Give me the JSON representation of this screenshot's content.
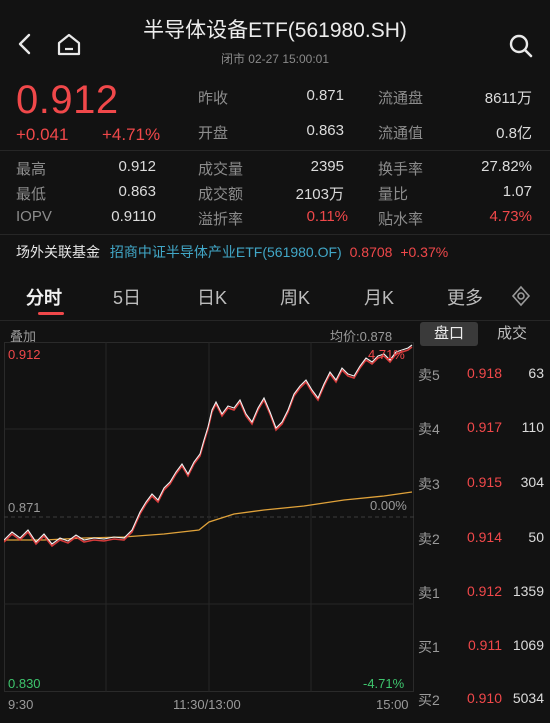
{
  "header": {
    "title": "半导体设备ETF(561980.SH)",
    "status": "闭市 02-27 15:00:01"
  },
  "quote": {
    "price": "0.912",
    "change": "+0.041",
    "change_pct": "+4.71%",
    "stats_top": [
      {
        "label": "昨收",
        "value": "0.871",
        "label2": "流通盘",
        "value2": "8611万"
      },
      {
        "label": "开盘",
        "value": "0.863",
        "label2": "流通值",
        "value2": "0.8亿"
      }
    ],
    "stats": [
      {
        "label": "最高",
        "value": "0.912",
        "label2": "成交量",
        "value2": "2395",
        "label3": "换手率",
        "value3": "27.82%"
      },
      {
        "label": "最低",
        "value": "0.863",
        "label2": "成交额",
        "value2": "2103万",
        "label3": "量比",
        "value3": "1.07"
      },
      {
        "label": "IOPV",
        "value": "0.9110",
        "label2": "溢折率",
        "value2": "0.11%",
        "label3": "贴水率",
        "value3": "4.73%"
      }
    ]
  },
  "linked_fund": {
    "label": "场外关联基金",
    "name": "招商中证半导体产业ETF(561980.OF)",
    "price": "0.8708",
    "change_pct": "+0.37%"
  },
  "tabs": [
    "分时",
    "5日",
    "日K",
    "周K",
    "月K",
    "更多"
  ],
  "chart": {
    "overlay_label": "叠加",
    "avg_label": "均价:0.878",
    "y_top": "0.912",
    "y_mid": "0.871",
    "y_bottom": "0.830",
    "pct_top": "4.71%",
    "pct_mid": "0.00%",
    "pct_bottom": "-4.71%",
    "x_labels": [
      "9:30",
      "11:30/13:00",
      "15:00"
    ]
  },
  "orderbook": {
    "tabs": [
      "盘口",
      "成交"
    ],
    "rows": [
      {
        "label": "卖5",
        "price": "0.918",
        "volume": "63"
      },
      {
        "label": "卖4",
        "price": "0.917",
        "volume": "110"
      },
      {
        "label": "卖3",
        "price": "0.915",
        "volume": "304"
      },
      {
        "label": "卖2",
        "price": "0.914",
        "volume": "50"
      },
      {
        "label": "卖1",
        "price": "0.912",
        "volume": "1359"
      },
      {
        "label": "买1",
        "price": "0.911",
        "volume": "1069"
      },
      {
        "label": "买2",
        "price": "0.910",
        "volume": "5034"
      }
    ]
  },
  "colors": {
    "up": "#f0484a",
    "down": "#3ec46d",
    "avg_line": "#e0a23a",
    "price_line": "#ffffff"
  }
}
